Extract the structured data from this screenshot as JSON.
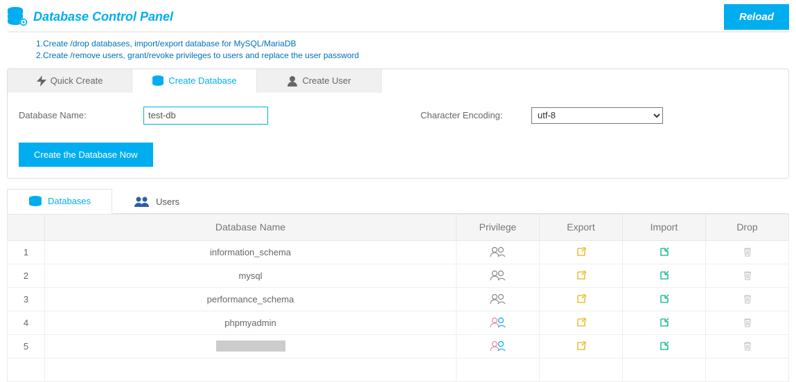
{
  "header": {
    "title": "Database Control Panel",
    "reload": "Reload"
  },
  "intro": {
    "line1": "1.Create /drop databases, import/export database for MySQL/MariaDB",
    "line2": "2.Create /remove users, grant/revoke privileges to users and replace the user password"
  },
  "tabs": {
    "quick": "Quick Create",
    "create_db": "Create Database",
    "create_user": "Create User"
  },
  "form": {
    "db_name_label": "Database Name:",
    "db_name_value": "test-db",
    "encoding_label": "Character Encoding:",
    "encoding_value": "utf-8",
    "submit": "Create the Database Now"
  },
  "list_tabs": {
    "databases": "Databases",
    "users": "Users"
  },
  "grid": {
    "headers": {
      "name": "Database Name",
      "priv": "Privilege",
      "exp": "Export",
      "imp": "Import",
      "drop": "Drop"
    },
    "rows": [
      {
        "idx": "1",
        "name": "information_schema",
        "priv_style": "gray"
      },
      {
        "idx": "2",
        "name": "mysql",
        "priv_style": "gray"
      },
      {
        "idx": "3",
        "name": "performance_schema",
        "priv_style": "gray"
      },
      {
        "idx": "4",
        "name": "phpmyadmin",
        "priv_style": "color"
      },
      {
        "idx": "5",
        "name": "",
        "priv_style": "color",
        "redacted": true
      }
    ]
  }
}
